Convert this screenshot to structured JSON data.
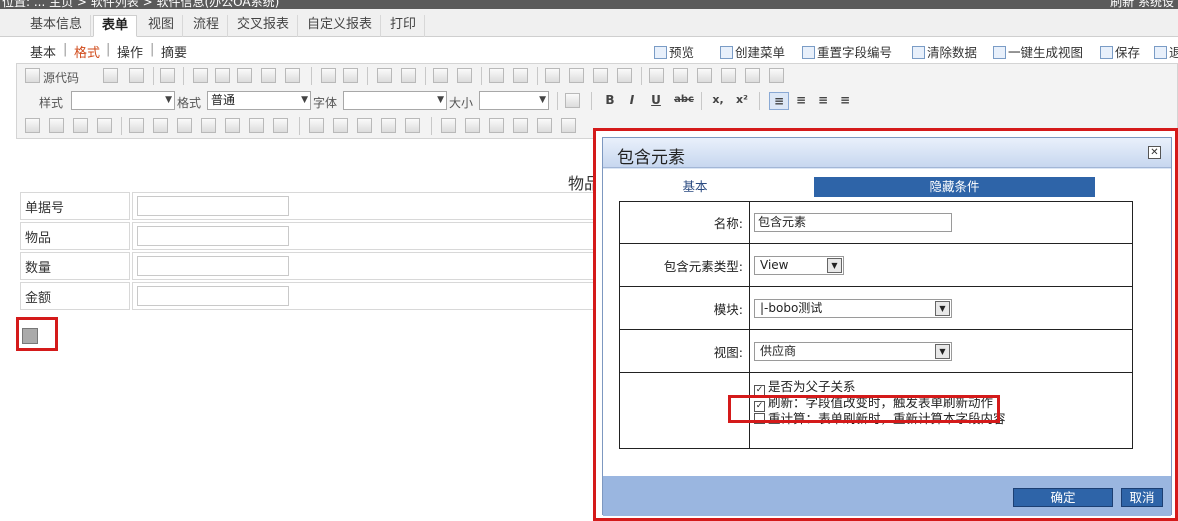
{
  "topbar": {
    "breadcrumb": "位置: ... 主页 > 软件列表 > 软件信息(办公OA系统)",
    "right": "刷新  系统设"
  },
  "tabs": [
    "基本信息",
    "表单",
    "视图",
    "流程",
    "交叉报表",
    "自定义报表",
    "打印"
  ],
  "subnav": {
    "items": [
      "基本",
      "格式",
      "操作",
      "摘要"
    ],
    "actions": [
      "预览",
      "创建菜单",
      "重置字段编号",
      "清除数据",
      "一键生成视图",
      "保存",
      "退"
    ]
  },
  "toolbar": {
    "source_label": "源代码",
    "style_label": "样式",
    "format_label": "格式",
    "format_value": "普通",
    "font_label": "字体",
    "size_label": "大小",
    "bold": "B",
    "italic": "I",
    "underline": "U",
    "strike": "abc",
    "subscript": "x,",
    "superscript": "x²"
  },
  "form": {
    "title": "物品",
    "rows": [
      "单据号",
      "物品",
      "数量",
      "金额"
    ]
  },
  "dialog": {
    "title": "包含元素",
    "tab_basic": "基本",
    "tab_hidden": "隐藏条件",
    "name_label": "名称:",
    "name_value": "包含元素",
    "type_label": "包含元素类型:",
    "type_value": "View",
    "module_label": "模块:",
    "module_value": "|-bobo测试",
    "view_label": "视图:",
    "view_value": "供应商",
    "check_parent": "是否为父子关系",
    "check_refresh": "刷新：字段值改变时，触发表单刷新动作",
    "check_recalc": "重计算：表单刷新时，重新计算本字段内容",
    "ok": "确定",
    "cancel": "取消"
  }
}
